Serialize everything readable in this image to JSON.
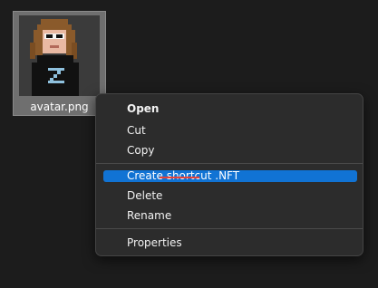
{
  "desktop": {
    "file": {
      "name": "avatar.png",
      "thumbnail": "pixel-art-avatar-image"
    }
  },
  "context_menu": {
    "items": [
      {
        "label": "Open",
        "bold": true
      },
      {
        "label": "Cut"
      },
      {
        "label": "Copy"
      },
      {
        "label": "Create shortcut .NFT",
        "highlighted": true
      },
      {
        "label": "Delete"
      },
      {
        "label": "Rename"
      },
      {
        "label": "Properties"
      }
    ]
  },
  "colors": {
    "background": "#1c1c1c",
    "menu_background": "#2c2c2c",
    "highlight": "#1173d4",
    "annotation": "#e5433a"
  }
}
